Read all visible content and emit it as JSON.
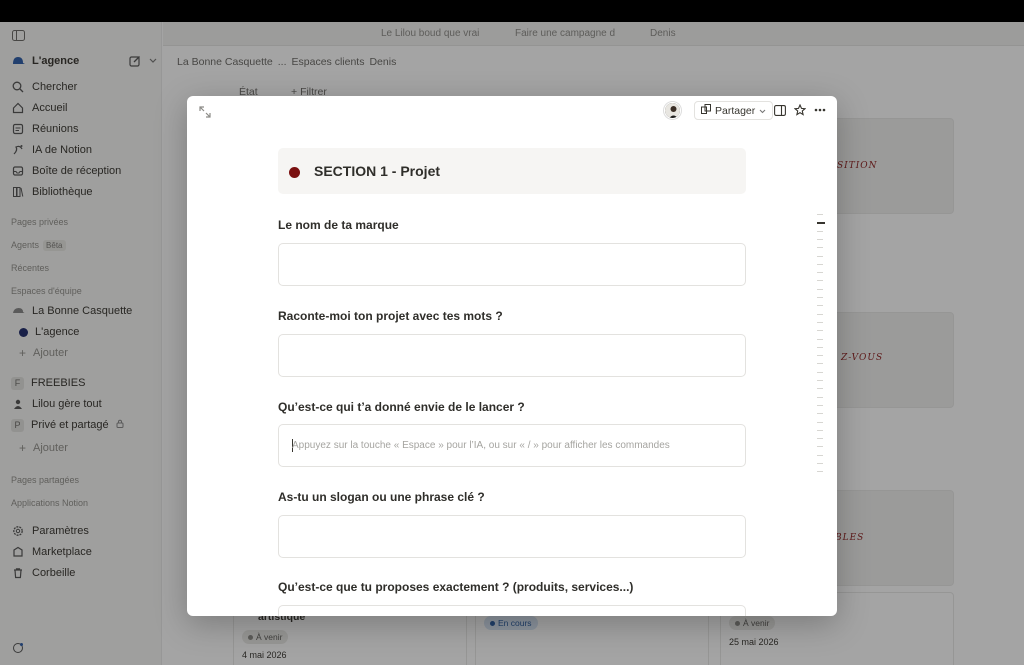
{
  "sidebar": {
    "workspace": "L'agence",
    "nav": [
      {
        "icon": "search-icon",
        "label": "Chercher"
      },
      {
        "icon": "home-icon",
        "label": "Accueil"
      },
      {
        "icon": "meetings-icon",
        "label": "Réunions"
      },
      {
        "icon": "ai-icon",
        "label": "IA de Notion"
      },
      {
        "icon": "inbox-icon",
        "label": "Boîte de réception"
      },
      {
        "icon": "library-icon",
        "label": "Bibliothèque"
      }
    ],
    "private_pages": "Pages privées",
    "agents": "Agents",
    "agents_badge": "Bêta",
    "recents": "Récentes",
    "team_spaces": "Espaces d'équipe",
    "team_items": [
      "La Bonne Casquette",
      "L'agence",
      "Ajouter"
    ],
    "page_items": [
      {
        "prefix": "F",
        "label": "FREEBIES"
      },
      {
        "prefix": "",
        "label": "Lilou gère tout"
      },
      {
        "prefix": "P",
        "label": "Privé et partagé"
      },
      {
        "prefix": "",
        "label": "Ajouter"
      }
    ],
    "shared_pages": "Pages partagées",
    "notion_apps": "Applications Notion",
    "bottom": [
      {
        "icon": "gear-icon",
        "label": "Paramètres"
      },
      {
        "icon": "marketplace-icon",
        "label": "Marketplace"
      },
      {
        "icon": "trash-icon",
        "label": "Corbeille"
      }
    ]
  },
  "browser_tabs": [
    "Le Lilou boud que vrai",
    "Faire une campagne d",
    "Denis"
  ],
  "breadcrumb": [
    "La Bonne Casquette",
    "...",
    "Espaces clients",
    "Denis"
  ],
  "filters": {
    "state": "État",
    "filter": "Filtrer"
  },
  "board": {
    "card1_title": "artistique",
    "card1_status": "À venir",
    "card1_date": "4 mai 2026",
    "card2_status": "En cours",
    "card3_status": "À venir",
    "card3_date": "25 mai 2026",
    "script1": "SITION",
    "script2": "Z-VOUS",
    "script3": "BLES"
  },
  "modal": {
    "share_label": "Partager",
    "section_title": "SECTION 1 - Projet",
    "section_dot_color": "#7a1010",
    "questions": [
      {
        "label": "Le nom de ta marque",
        "value": ""
      },
      {
        "label": "Raconte-moi ton projet avec tes mots ?",
        "value": ""
      },
      {
        "label": "Qu’est-ce qui t’a donné envie de le lancer ?",
        "placeholder": "Appuyez sur la touche « Espace » pour l’IA, ou sur « / » pour afficher les commandes"
      },
      {
        "label": "As-tu un slogan ou une phrase clé ?",
        "value": ""
      },
      {
        "label": "Qu’est-ce que tu proposes exactement ? (produits, services...)",
        "value": ""
      }
    ]
  }
}
